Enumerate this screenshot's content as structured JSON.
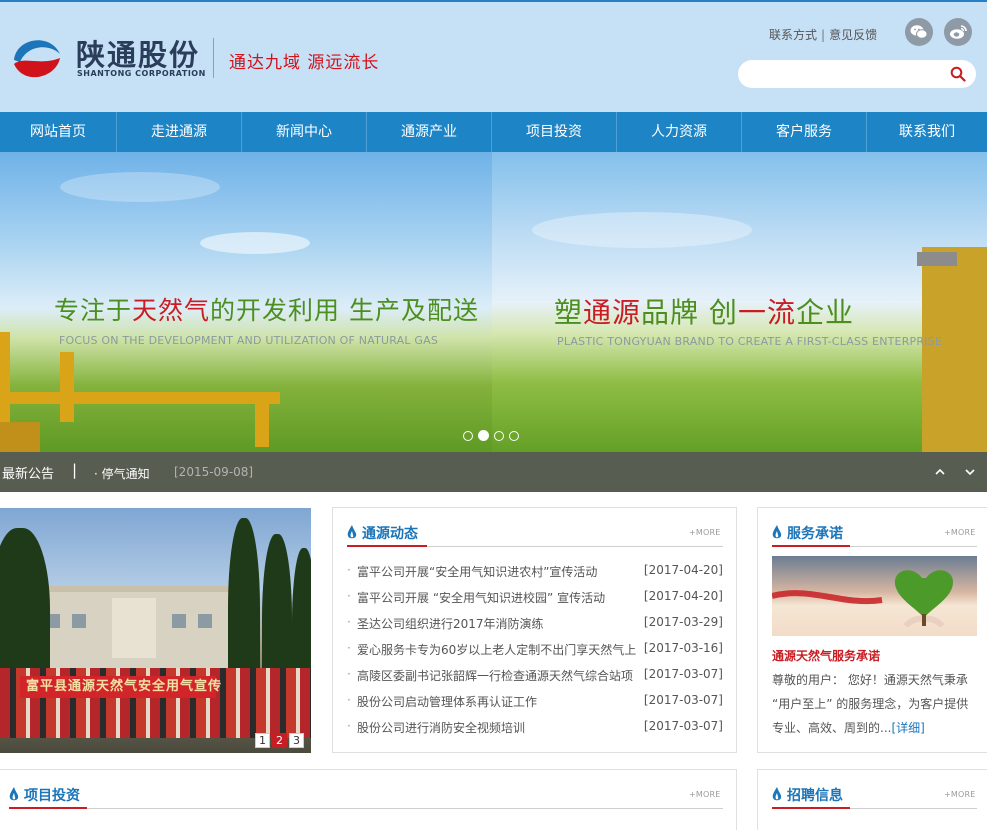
{
  "header": {
    "logo_cn": "陕通股份",
    "logo_en": "SHANTONG CORPORATION",
    "slogan": "通达九域 源远流长",
    "links": [
      "联系方式",
      "意见反馈"
    ],
    "link_separator": "|",
    "social_icons": [
      "wechat-icon",
      "weibo-icon"
    ],
    "search_placeholder": ""
  },
  "nav": {
    "items": [
      "网站首页",
      "走进通源",
      "新闻中心",
      "通源产业",
      "项目投资",
      "人力资源",
      "客户服务",
      "联系我们"
    ]
  },
  "banner": {
    "slide1": {
      "cn_part1": "专注于",
      "cn_part2": "天然气",
      "cn_part3": "的开发利用  生产及配送",
      "en": "FOCUS ON THE DEVELOPMENT AND UTILIZATION OF NATURAL GAS"
    },
    "slide2": {
      "cn_part1": "塑",
      "cn_part2": "通源",
      "cn_part3": "品牌  创",
      "cn_part4": "一流",
      "cn_part5": "企业",
      "en": "PLASTIC TONGYUAN BRAND TO CREATE A FIRST-CLASS ENTERPRISE"
    },
    "dot_count": 4,
    "active_dot": 2
  },
  "notice": {
    "title": "最新公告",
    "separator": "|",
    "item": "· 停气通知",
    "date": "[2015-09-08]"
  },
  "photo": {
    "banner_text": "富平县通源天然气安全用气宣传",
    "pages": [
      "1",
      "2",
      "3"
    ],
    "active_page": 2
  },
  "news": {
    "title": "通源动态",
    "more": "+MORE",
    "items": [
      {
        "title": "富平公司开展“安全用气知识进农村”宣传活动",
        "date": "[2017-04-20]"
      },
      {
        "title": "富平公司开展 “安全用气知识进校园” 宣传活动",
        "date": "[2017-04-20]"
      },
      {
        "title": "圣达公司组织进行2017年消防演练",
        "date": "[2017-03-29]"
      },
      {
        "title": "爱心服务卡专为60岁以上老人定制不出门享天然气上",
        "date": "[2017-03-16]"
      },
      {
        "title": "高陵区委副书记张韶辉一行检查通源天然气综合站项",
        "date": "[2017-03-07]"
      },
      {
        "title": "股份公司启动管理体系再认证工作",
        "date": "[2017-03-07]"
      },
      {
        "title": "股份公司进行消防安全视频培训",
        "date": "[2017-03-07]"
      }
    ]
  },
  "promise": {
    "title": "服务承诺",
    "more": "+MORE",
    "heading": "通源天然气服务承诺",
    "text": "尊敬的用户： 您好！通源天然气秉承 “用户至上” 的服务理念，为客户提供专业、高效、周到的...",
    "detail_link": "[详细]"
  },
  "projects": {
    "title": "项目投资",
    "more": "+MORE"
  },
  "jobs": {
    "title": "招聘信息",
    "more": "+MORE"
  },
  "colors": {
    "header_bg": "#c6e0f5",
    "nav_bg": "#1d84c6",
    "brand_red": "#c81d23",
    "brand_blue": "#1b75b8"
  }
}
